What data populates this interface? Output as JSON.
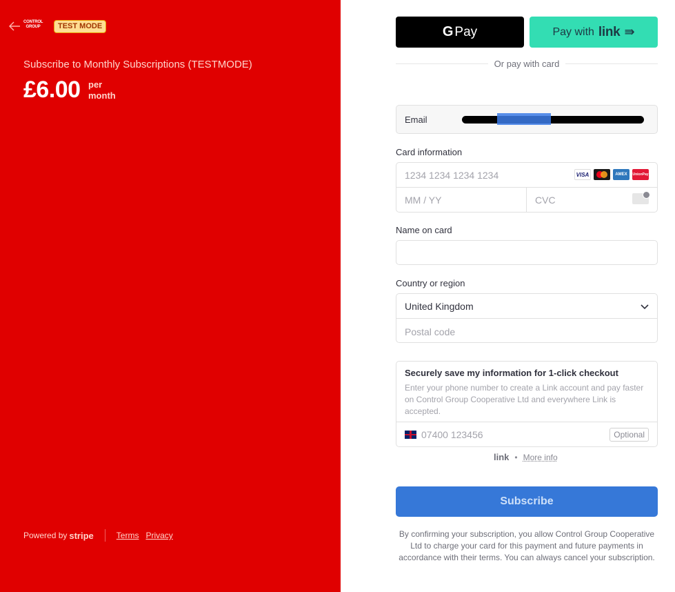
{
  "summary": {
    "logo_text": "CONTROL GROUP",
    "test_mode_badge": "TEST MODE",
    "title": "Subscribe to Monthly Subscriptions (TESTMODE)",
    "price": "£6.00",
    "period_line1": "per",
    "period_line2": "month"
  },
  "footer": {
    "powered_by": "Powered by",
    "brand": "stripe",
    "terms": "Terms",
    "privacy": "Privacy"
  },
  "wallets": {
    "gpay_g": "G",
    "gpay_label": "Pay",
    "link_prefix": "Pay with",
    "link_brand": "link",
    "link_arrow": "⇛"
  },
  "divider_text": "Or pay with card",
  "email": {
    "label": "Email"
  },
  "card": {
    "label": "Card information",
    "number_placeholder": "1234 1234 1234 1234",
    "expiry_placeholder": "MM / YY",
    "cvc_placeholder": "CVC",
    "brands": [
      "VISA",
      "",
      "AMEX",
      "UnionPay"
    ]
  },
  "name": {
    "label": "Name on card"
  },
  "country": {
    "label": "Country or region",
    "value": "United Kingdom",
    "postal_placeholder": "Postal code"
  },
  "save_info": {
    "title": "Securely save my information for 1-click checkout",
    "description": "Enter your phone number to create a Link account and pay faster on Control Group Cooperative Ltd and everywhere Link is accepted.",
    "phone_placeholder": "07400 123456",
    "optional_badge": "Optional"
  },
  "link_info": {
    "brand": "link",
    "dot": "•",
    "more_info": "More info"
  },
  "subscribe_label": "Subscribe",
  "legal_text": "By confirming your subscription, you allow Control Group Cooperative Ltd to charge your card for this payment and future payments in accordance with their terms. You can always cancel your subscription.",
  "colors": {
    "left_panel": "#e00000",
    "primary_button": "#3678d8",
    "link_green": "#33ddb3"
  }
}
